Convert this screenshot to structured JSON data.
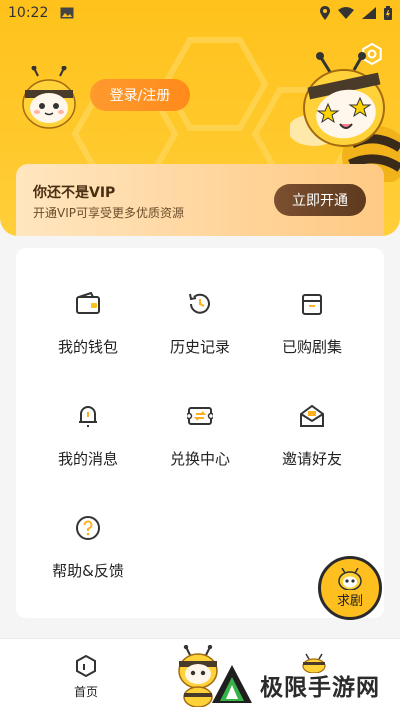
{
  "status_bar": {
    "time": "10:22"
  },
  "header": {
    "login_label": "登录/注册"
  },
  "vip": {
    "title": "你还不是VIP",
    "subtitle": "开通VIP可享受更多优质资源",
    "button_label": "立即开通"
  },
  "menu": {
    "items": [
      {
        "label": "我的钱包",
        "icon": "wallet-icon"
      },
      {
        "label": "历史记录",
        "icon": "history-icon"
      },
      {
        "label": "已购剧集",
        "icon": "purchased-icon"
      },
      {
        "label": "我的消息",
        "icon": "bell-icon"
      },
      {
        "label": "兑换中心",
        "icon": "exchange-icon"
      },
      {
        "label": "邀请好友",
        "icon": "mail-icon"
      },
      {
        "label": "帮助&反馈",
        "icon": "help-icon"
      }
    ]
  },
  "float_button": {
    "label": "求剧"
  },
  "bottom_nav": {
    "home_label": "首页"
  },
  "watermark": {
    "text": "极限手游网"
  },
  "colors": {
    "brand_yellow": "#ffc21c",
    "login_orange": "#ff8a1a",
    "vip_button_brown": "#5e3a1e",
    "icon_stroke": "#333333"
  }
}
